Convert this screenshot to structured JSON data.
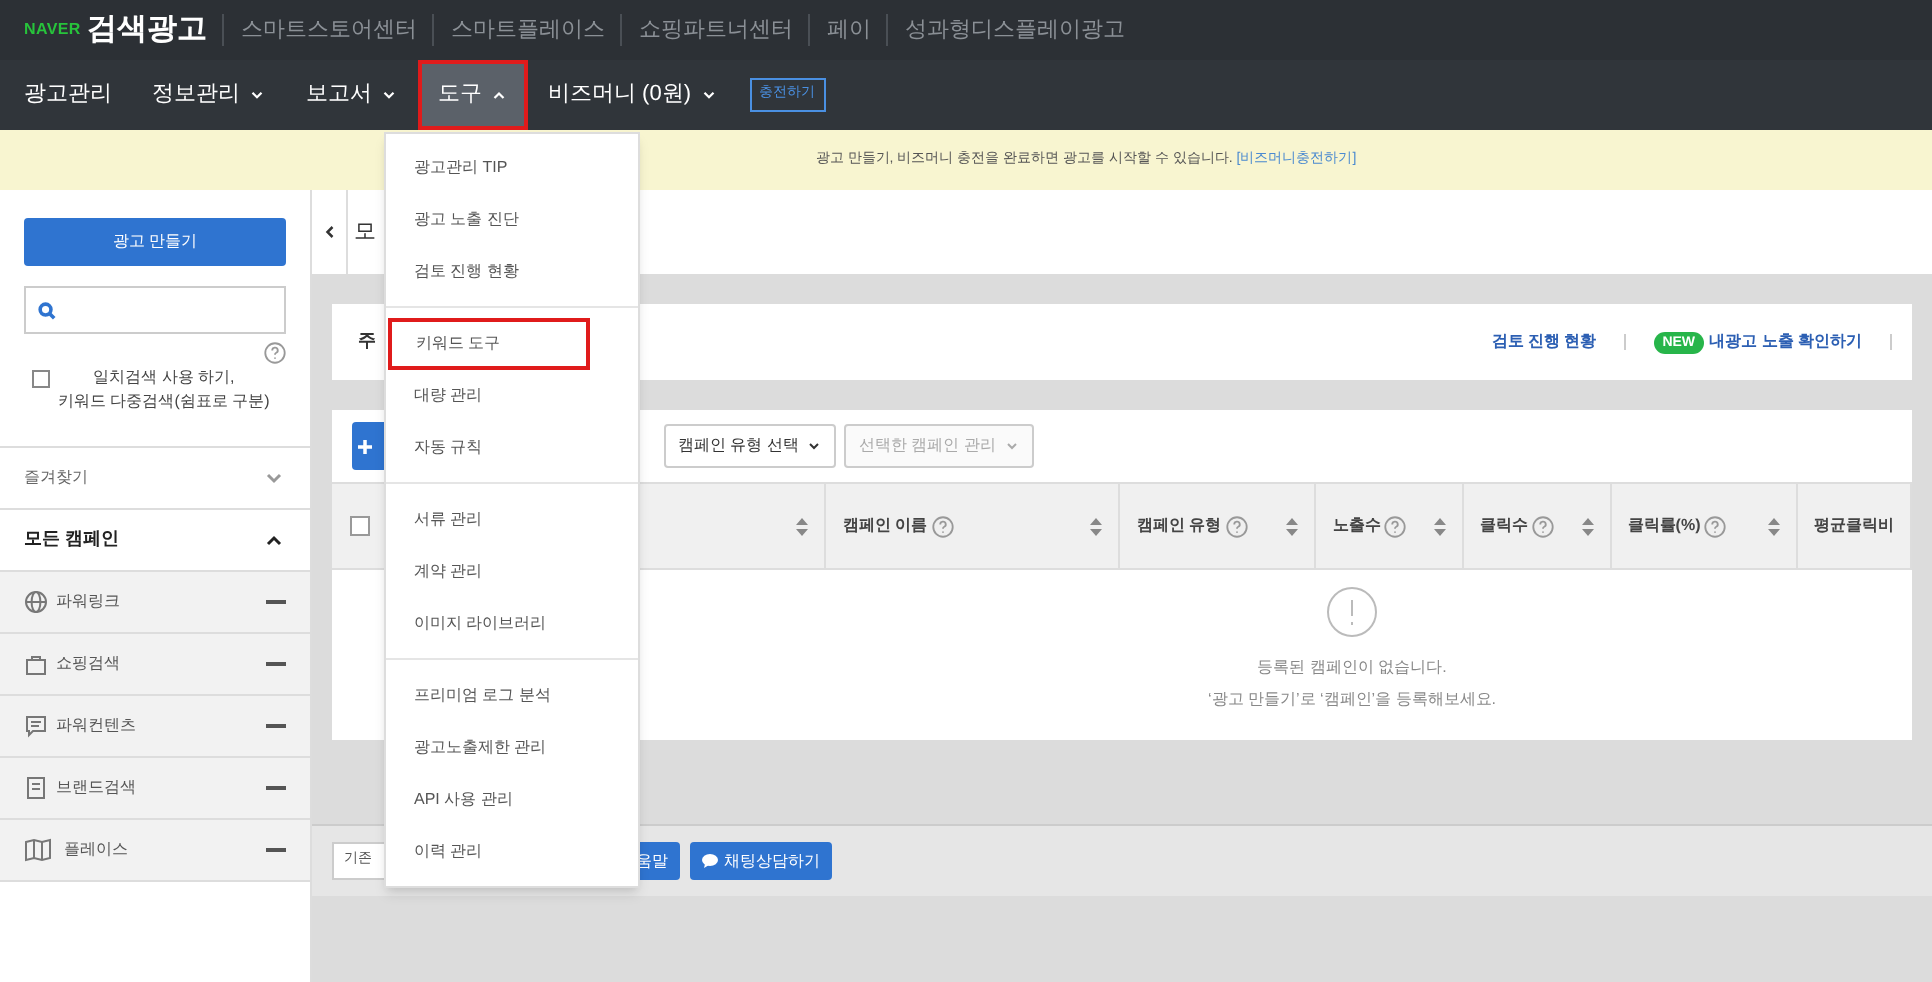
{
  "topbar": {
    "brand": "NAVER",
    "title": "검색광고",
    "links": [
      "스마트스토어센터",
      "스마트플레이스",
      "쇼핑파트너센터",
      "페이",
      "성과형디스플레이광고"
    ]
  },
  "nav": {
    "items": [
      {
        "label": "광고관리",
        "selected": false,
        "highlighted": false
      },
      {
        "label": "정보관리",
        "expanded": false,
        "selected": false,
        "highlighted": false
      },
      {
        "label": "보고서",
        "expanded": false,
        "selected": false,
        "highlighted": false
      },
      {
        "label": "도구",
        "expanded": true,
        "selected": true,
        "highlighted": true
      },
      {
        "label": "비즈머니 (0원)",
        "expanded": false,
        "selected": false,
        "highlighted": false
      }
    ],
    "charge_button": "충전하기"
  },
  "banner": {
    "text": "광고 만들기, 비즈머니 충전을 완료하면 광고를 시작할 수 있습니다.",
    "link": "[비즈머니충전하기]"
  },
  "sidebar": {
    "create_button": "광고 만들기",
    "exact_match": {
      "checked": false,
      "lines": [
        "일치검색 사용 하기,",
        "키워드 다중검색(쉼표로 구분)"
      ]
    },
    "favorites": {
      "label": "즐겨찾기",
      "expanded": false
    },
    "all_campaigns": {
      "label": "모든 캠페인",
      "expanded": true,
      "items": [
        {
          "label": "파워링크",
          "kind": "globe"
        },
        {
          "label": "쇼핑검색",
          "kind": "bag"
        },
        {
          "label": "파워컨텐츠",
          "kind": "content"
        },
        {
          "label": "브랜드검색",
          "kind": "brand"
        },
        {
          "label": "플레이스",
          "kind": "place"
        }
      ]
    }
  },
  "main": {
    "page_title": "모",
    "summary_label": "주",
    "summary_links": [
      {
        "label": "검토 진행 현황"
      },
      {
        "label": "내광고 노출 확인하기",
        "badge": "NEW"
      }
    ],
    "toolbar": {
      "selects": [
        {
          "label": "캠페인 유형 선택",
          "disabled": false
        },
        {
          "label": "선택한 캠페인 관리",
          "disabled": true
        }
      ]
    },
    "table": {
      "select_all_checked": false,
      "columns": [
        {
          "label": "캠페인 이름",
          "help": true,
          "sortable": true
        },
        {
          "label": "캠페인 유형",
          "help": true,
          "sortable": true
        },
        {
          "label": "노출수",
          "help": true,
          "sortable": true
        },
        {
          "label": "클릭수",
          "help": true,
          "sortable": true
        },
        {
          "label": "클릭률(%)",
          "help": true,
          "sortable": true
        },
        {
          "label": "평균클릭비",
          "help": false,
          "sortable": false
        }
      ],
      "empty_title": "등록된 캠페인이 없습니다.",
      "empty_hint": "‘광고 만들기’로 ‘캠페인’을 등록해보세요."
    },
    "footer": {
      "date_label": "기존",
      "help_button": "움말",
      "chat_button": "채팅상담하기"
    }
  },
  "dropdown": {
    "groups": [
      [
        {
          "label": "광고관리 TIP",
          "highlighted": false
        },
        {
          "label": "광고 노출 진단",
          "highlighted": false
        },
        {
          "label": "검토 진행 현황",
          "highlighted": false
        }
      ],
      [
        {
          "label": "키워드 도구",
          "highlighted": true
        },
        {
          "label": "대량 관리",
          "highlighted": false
        },
        {
          "label": "자동 규칙",
          "highlighted": false
        }
      ],
      [
        {
          "label": "서류 관리",
          "highlighted": false
        },
        {
          "label": "계약 관리",
          "highlighted": false
        },
        {
          "label": "이미지 라이브러리",
          "highlighted": false
        }
      ],
      [
        {
          "label": "프리미엄 로그 분석",
          "highlighted": false
        },
        {
          "label": "광고노출제한 관리",
          "highlighted": false
        },
        {
          "label": "API 사용 관리",
          "highlighted": false
        },
        {
          "label": "이력 관리",
          "highlighted": false
        }
      ]
    ]
  }
}
